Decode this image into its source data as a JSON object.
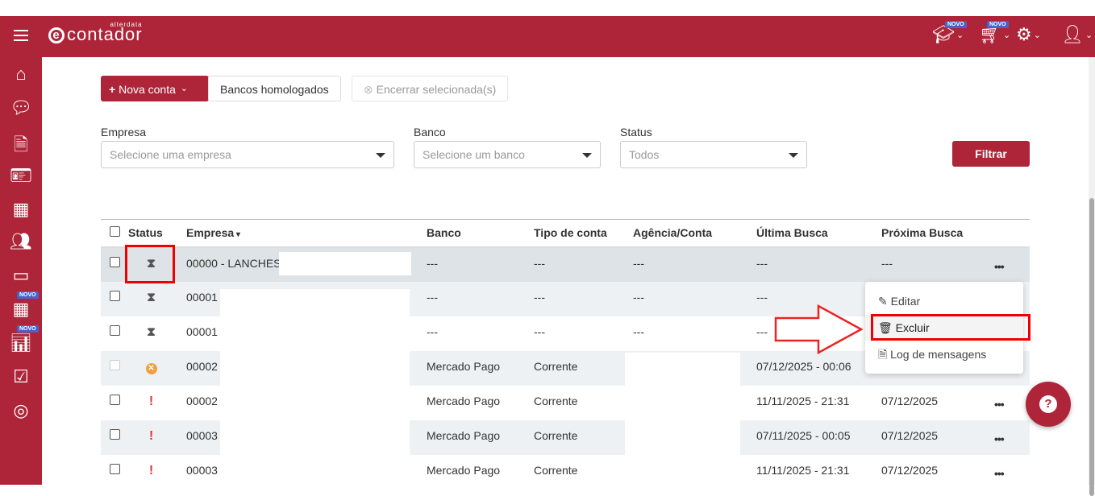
{
  "header": {
    "logo_text": "contador",
    "logo_brand": "alterdata",
    "novo_badge": "NOVO"
  },
  "sidebar": {
    "items": [
      "home",
      "chat",
      "document",
      "contacts",
      "building",
      "users",
      "credit-card",
      "calculator",
      "chart",
      "check",
      "target"
    ]
  },
  "toolbar": {
    "new_account": "Nova conta",
    "approved_banks": "Bancos homologados",
    "close_selected": "Encerrar selecionada(s)"
  },
  "filters": {
    "company_label": "Empresa",
    "company_placeholder": "Selecione uma empresa",
    "bank_label": "Banco",
    "bank_placeholder": "Selecione um banco",
    "status_label": "Status",
    "status_value": "Todos",
    "filter_button": "Filtrar"
  },
  "table": {
    "headers": [
      "Status",
      "Empresa",
      "Banco",
      "Tipo de conta",
      "Agência/Conta",
      "Última Busca",
      "Próxima Busca"
    ],
    "rows": [
      {
        "status": "pending",
        "empresa": "00000 - LANCHES",
        "banco": "---",
        "tipo": "---",
        "agencia": "---",
        "ultima": "---",
        "proxima": "---"
      },
      {
        "status": "pending",
        "empresa": "00001",
        "banco": "---",
        "tipo": "---",
        "agencia": "---",
        "ultima": "---",
        "proxima": ""
      },
      {
        "status": "pending",
        "empresa": "00001",
        "banco": "---",
        "tipo": "---",
        "agencia": "---",
        "ultima": "---",
        "proxima": ""
      },
      {
        "status": "error",
        "empresa": "00002",
        "banco": "Mercado Pago",
        "tipo": "Corrente",
        "agencia": "",
        "ultima": "07/12/2025 - 00:06",
        "proxima": ""
      },
      {
        "status": "alert",
        "empresa": "00002",
        "banco": "Mercado Pago",
        "tipo": "Corrente",
        "agencia": "",
        "ultima": "11/11/2025 - 21:31",
        "proxima": "07/12/2025"
      },
      {
        "status": "alert",
        "empresa": "00003",
        "banco": "Mercado Pago",
        "tipo": "Corrente",
        "agencia": "",
        "ultima": "07/11/2025 - 00:05",
        "proxima": "07/12/2025"
      },
      {
        "status": "alert",
        "empresa": "00003",
        "banco": "Mercado Pago",
        "tipo": "Corrente",
        "agencia": "",
        "ultima": "11/11/2025 - 21:31",
        "proxima": "07/12/2025"
      }
    ]
  },
  "context_menu": {
    "edit": "Editar",
    "delete": "Excluir",
    "log": "Log de mensagens"
  },
  "colors": {
    "brand": "#ae2438",
    "badge": "#4a62c9"
  }
}
